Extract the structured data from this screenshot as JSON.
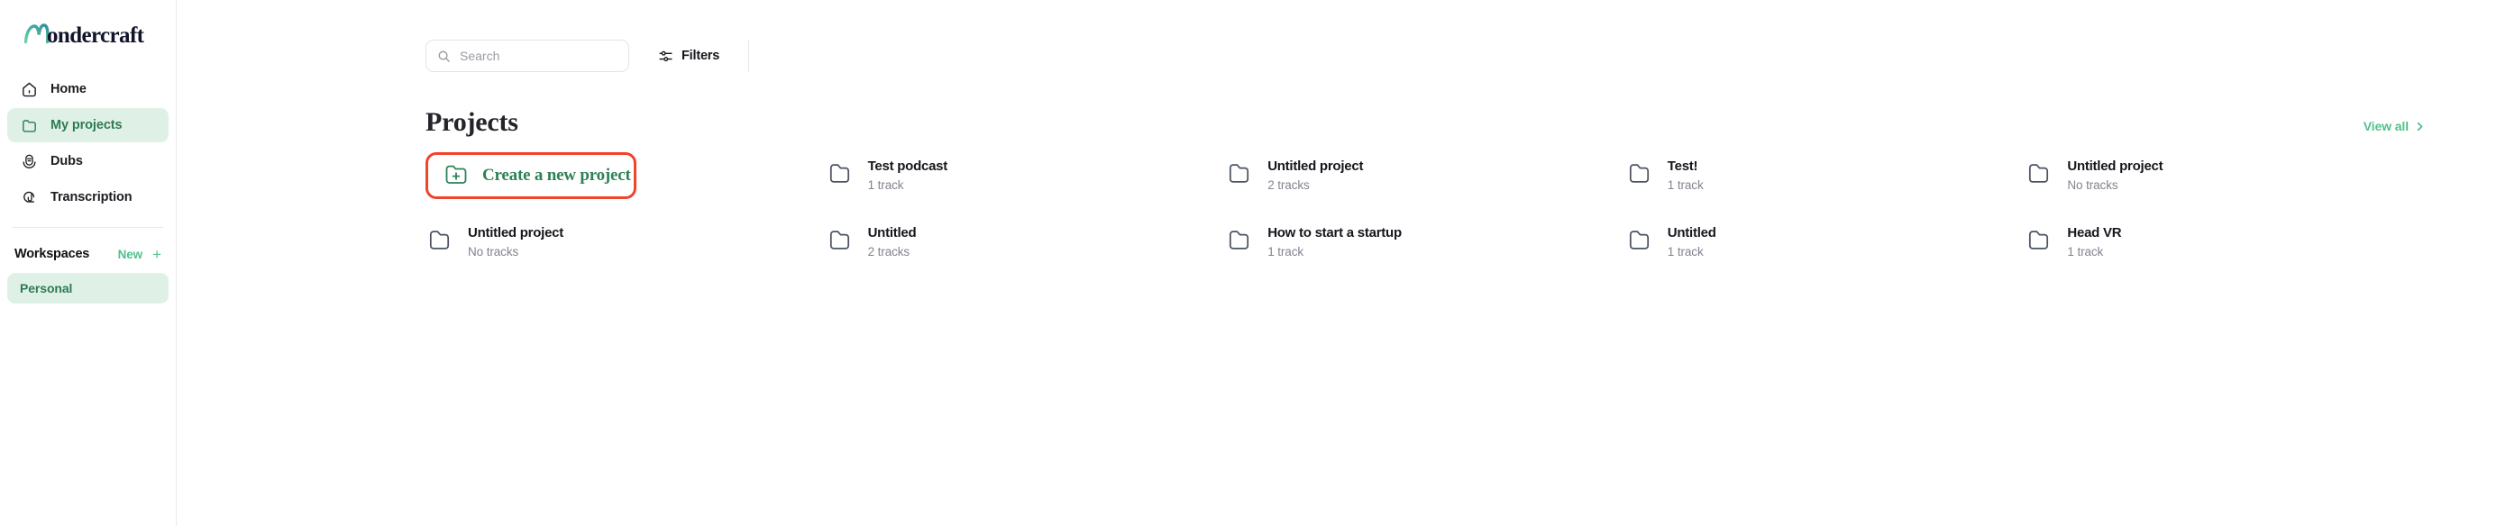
{
  "brand": {
    "name": "Wondercraft",
    "accent": "#53c08c",
    "logo_mark": "wondercraft-logo"
  },
  "sidebar": {
    "items": [
      {
        "label": "Home",
        "icon": "home-icon",
        "active": false
      },
      {
        "label": "My projects",
        "icon": "folder-icon",
        "active": true
      },
      {
        "label": "Dubs",
        "icon": "microphone-icon",
        "active": false
      },
      {
        "label": "Transcription",
        "icon": "transcription-icon",
        "active": false
      }
    ],
    "workspaces": {
      "title": "Workspaces",
      "new_label": "New",
      "plus_icon": "plus-icon",
      "items": [
        {
          "label": "Personal",
          "active": true
        }
      ]
    }
  },
  "topbar": {
    "search": {
      "placeholder": "Search",
      "value": "",
      "icon": "search-icon"
    },
    "filters": {
      "label": "Filters",
      "icon": "sliders-icon"
    }
  },
  "main": {
    "section_title": "Projects",
    "view_all": {
      "label": "View all",
      "icon": "chevron-right-icon"
    },
    "create": {
      "label": "Create a new project",
      "icon": "folder-plus-icon",
      "highlight_color": "#f0442c"
    },
    "projects": [
      {
        "name": "Test podcast",
        "tracks": "1 track"
      },
      {
        "name": "Untitled project",
        "tracks": "2 tracks"
      },
      {
        "name": "Test!",
        "tracks": "1 track"
      },
      {
        "name": "Untitled project",
        "tracks": "No tracks"
      },
      {
        "name": "Untitled project",
        "tracks": "No tracks"
      },
      {
        "name": "Untitled",
        "tracks": "2 tracks"
      },
      {
        "name": "How to start a startup",
        "tracks": "1 track"
      },
      {
        "name": "Untitled",
        "tracks": "1 track"
      },
      {
        "name": "Head VR",
        "tracks": "1 track"
      }
    ]
  }
}
